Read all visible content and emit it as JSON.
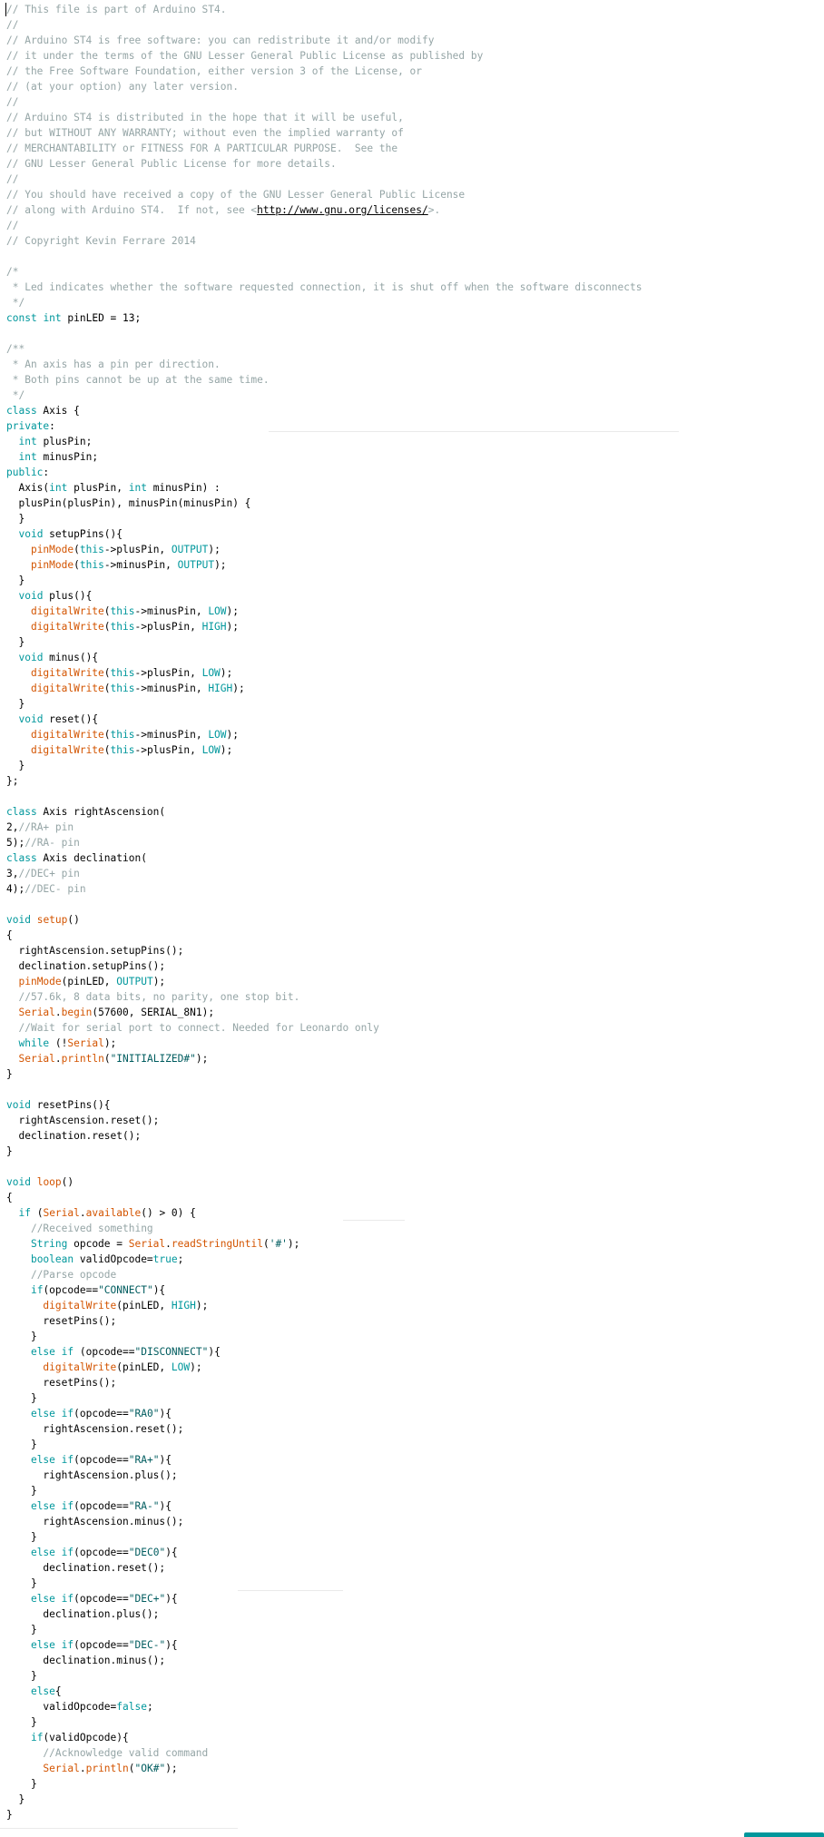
{
  "editor": {
    "colors": {
      "comment": "#95a5a6",
      "keyword": "#00979c",
      "function": "#d35400",
      "string": "#005c5f",
      "text": "#000000",
      "background": "#ffffff"
    },
    "lines": [
      [
        [
          "c",
          "// This file is part of Arduino ST4."
        ]
      ],
      [
        [
          "c",
          "//"
        ]
      ],
      [
        [
          "c",
          "// Arduino ST4 is free software: you can redistribute it and/or modify"
        ]
      ],
      [
        [
          "c",
          "// it under the terms of the GNU Lesser General Public License as published by"
        ]
      ],
      [
        [
          "c",
          "// the Free Software Foundation, either version 3 of the License, or"
        ]
      ],
      [
        [
          "c",
          "// (at your option) any later version."
        ]
      ],
      [
        [
          "c",
          "//"
        ]
      ],
      [
        [
          "c",
          "// Arduino ST4 is distributed in the hope that it will be useful,"
        ]
      ],
      [
        [
          "c",
          "// but WITHOUT ANY WARRANTY; without even the implied warranty of"
        ]
      ],
      [
        [
          "c",
          "// MERCHANTABILITY or FITNESS FOR A PARTICULAR PURPOSE.  See the"
        ]
      ],
      [
        [
          "c",
          "// GNU Lesser General Public License for more details."
        ]
      ],
      [
        [
          "c",
          "//"
        ]
      ],
      [
        [
          "c",
          "// You should have received a copy of the GNU Lesser General Public License"
        ]
      ],
      [
        [
          "c",
          "// along with Arduino ST4.  If not, see <"
        ],
        [
          "l",
          "http://www.gnu.org/licenses/"
        ],
        [
          "c",
          ">."
        ]
      ],
      [
        [
          "c",
          "//"
        ]
      ],
      [
        [
          "c",
          "// Copyright Kevin Ferrare 2014"
        ]
      ],
      [],
      [
        [
          "m",
          "/*"
        ]
      ],
      [
        [
          "m",
          " * Led indicates whether the software requested connection, it is shut off when the software disconnects"
        ]
      ],
      [
        [
          "m",
          " */"
        ]
      ],
      [
        [
          "k",
          "const"
        ],
        [
          "t",
          " "
        ],
        [
          "k",
          "int"
        ],
        [
          "t",
          " pinLED = 13;"
        ]
      ],
      [],
      [
        [
          "m",
          "/**"
        ]
      ],
      [
        [
          "m",
          " * An axis has a pin per direction."
        ]
      ],
      [
        [
          "m",
          " * Both pins cannot be up at the same time."
        ]
      ],
      [
        [
          "m",
          " */"
        ]
      ],
      [
        [
          "k",
          "class"
        ],
        [
          "t",
          " Axis {"
        ]
      ],
      [
        [
          "k",
          "private"
        ],
        [
          "t",
          ":"
        ]
      ],
      [
        [
          "t",
          "  "
        ],
        [
          "k",
          "int"
        ],
        [
          "t",
          " plusPin;"
        ]
      ],
      [
        [
          "t",
          "  "
        ],
        [
          "k",
          "int"
        ],
        [
          "t",
          " minusPin;"
        ]
      ],
      [
        [
          "k",
          "public"
        ],
        [
          "t",
          ":"
        ]
      ],
      [
        [
          "t",
          "  Axis("
        ],
        [
          "k",
          "int"
        ],
        [
          "t",
          " plusPin, "
        ],
        [
          "k",
          "int"
        ],
        [
          "t",
          " minusPin) :"
        ]
      ],
      [
        [
          "t",
          "  plusPin(plusPin), minusPin(minusPin) {"
        ]
      ],
      [
        [
          "t",
          "  }"
        ]
      ],
      [
        [
          "t",
          "  "
        ],
        [
          "k",
          "void"
        ],
        [
          "t",
          " setupPins(){"
        ]
      ],
      [
        [
          "t",
          "    "
        ],
        [
          "f",
          "pinMode"
        ],
        [
          "t",
          "("
        ],
        [
          "k",
          "this"
        ],
        [
          "t",
          "->plusPin, "
        ],
        [
          "k",
          "OUTPUT"
        ],
        [
          "t",
          ");"
        ]
      ],
      [
        [
          "t",
          "    "
        ],
        [
          "f",
          "pinMode"
        ],
        [
          "t",
          "("
        ],
        [
          "k",
          "this"
        ],
        [
          "t",
          "->minusPin, "
        ],
        [
          "k",
          "OUTPUT"
        ],
        [
          "t",
          ");"
        ]
      ],
      [
        [
          "t",
          "  }"
        ]
      ],
      [
        [
          "t",
          "  "
        ],
        [
          "k",
          "void"
        ],
        [
          "t",
          " plus(){"
        ]
      ],
      [
        [
          "t",
          "    "
        ],
        [
          "f",
          "digitalWrite"
        ],
        [
          "t",
          "("
        ],
        [
          "k",
          "this"
        ],
        [
          "t",
          "->minusPin, "
        ],
        [
          "k",
          "LOW"
        ],
        [
          "t",
          ");"
        ]
      ],
      [
        [
          "t",
          "    "
        ],
        [
          "f",
          "digitalWrite"
        ],
        [
          "t",
          "("
        ],
        [
          "k",
          "this"
        ],
        [
          "t",
          "->plusPin, "
        ],
        [
          "k",
          "HIGH"
        ],
        [
          "t",
          ");"
        ]
      ],
      [
        [
          "t",
          "  }"
        ]
      ],
      [
        [
          "t",
          "  "
        ],
        [
          "k",
          "void"
        ],
        [
          "t",
          " minus(){"
        ]
      ],
      [
        [
          "t",
          "    "
        ],
        [
          "f",
          "digitalWrite"
        ],
        [
          "t",
          "("
        ],
        [
          "k",
          "this"
        ],
        [
          "t",
          "->plusPin, "
        ],
        [
          "k",
          "LOW"
        ],
        [
          "t",
          ");"
        ]
      ],
      [
        [
          "t",
          "    "
        ],
        [
          "f",
          "digitalWrite"
        ],
        [
          "t",
          "("
        ],
        [
          "k",
          "this"
        ],
        [
          "t",
          "->minusPin, "
        ],
        [
          "k",
          "HIGH"
        ],
        [
          "t",
          ");"
        ]
      ],
      [
        [
          "t",
          "  }"
        ]
      ],
      [
        [
          "t",
          "  "
        ],
        [
          "k",
          "void"
        ],
        [
          "t",
          " reset(){"
        ]
      ],
      [
        [
          "t",
          "    "
        ],
        [
          "f",
          "digitalWrite"
        ],
        [
          "t",
          "("
        ],
        [
          "k",
          "this"
        ],
        [
          "t",
          "->minusPin, "
        ],
        [
          "k",
          "LOW"
        ],
        [
          "t",
          ");"
        ]
      ],
      [
        [
          "t",
          "    "
        ],
        [
          "f",
          "digitalWrite"
        ],
        [
          "t",
          "("
        ],
        [
          "k",
          "this"
        ],
        [
          "t",
          "->plusPin, "
        ],
        [
          "k",
          "LOW"
        ],
        [
          "t",
          ");"
        ]
      ],
      [
        [
          "t",
          "  }"
        ]
      ],
      [
        [
          "t",
          "};"
        ]
      ],
      [],
      [
        [
          "k",
          "class"
        ],
        [
          "t",
          " Axis rightAscension("
        ]
      ],
      [
        [
          "t",
          "2,"
        ],
        [
          "c",
          "//RA+ pin"
        ]
      ],
      [
        [
          "t",
          "5);"
        ],
        [
          "c",
          "//RA- pin"
        ]
      ],
      [
        [
          "k",
          "class"
        ],
        [
          "t",
          " Axis declination("
        ]
      ],
      [
        [
          "t",
          "3,"
        ],
        [
          "c",
          "//DEC+ pin"
        ]
      ],
      [
        [
          "t",
          "4);"
        ],
        [
          "c",
          "//DEC- pin"
        ]
      ],
      [],
      [
        [
          "k",
          "void"
        ],
        [
          "t",
          " "
        ],
        [
          "f",
          "setup"
        ],
        [
          "t",
          "()"
        ]
      ],
      [
        [
          "t",
          "{"
        ]
      ],
      [
        [
          "t",
          "  rightAscension.setupPins();"
        ]
      ],
      [
        [
          "t",
          "  declination.setupPins();"
        ]
      ],
      [
        [
          "t",
          "  "
        ],
        [
          "f",
          "pinMode"
        ],
        [
          "t",
          "(pinLED, "
        ],
        [
          "k",
          "OUTPUT"
        ],
        [
          "t",
          ");"
        ]
      ],
      [
        [
          "t",
          "  "
        ],
        [
          "c",
          "//57.6k, 8 data bits, no parity, one stop bit."
        ]
      ],
      [
        [
          "t",
          "  "
        ],
        [
          "f",
          "Serial"
        ],
        [
          "t",
          "."
        ],
        [
          "f",
          "begin"
        ],
        [
          "t",
          "(57600, SERIAL_8N1);"
        ]
      ],
      [
        [
          "t",
          "  "
        ],
        [
          "c",
          "//Wait for serial port to connect. Needed for Leonardo only"
        ]
      ],
      [
        [
          "t",
          "  "
        ],
        [
          "k",
          "while"
        ],
        [
          "t",
          " (!"
        ],
        [
          "f",
          "Serial"
        ],
        [
          "t",
          ");"
        ]
      ],
      [
        [
          "t",
          "  "
        ],
        [
          "f",
          "Serial"
        ],
        [
          "t",
          "."
        ],
        [
          "f",
          "println"
        ],
        [
          "t",
          "("
        ],
        [
          "s",
          "\"INITIALIZED#\""
        ],
        [
          "t",
          ");"
        ]
      ],
      [
        [
          "t",
          "}"
        ]
      ],
      [],
      [
        [
          "k",
          "void"
        ],
        [
          "t",
          " resetPins(){"
        ]
      ],
      [
        [
          "t",
          "  rightAscension.reset();"
        ]
      ],
      [
        [
          "t",
          "  declination.reset();"
        ]
      ],
      [
        [
          "t",
          "}"
        ]
      ],
      [],
      [
        [
          "k",
          "void"
        ],
        [
          "t",
          " "
        ],
        [
          "f",
          "loop"
        ],
        [
          "t",
          "()"
        ]
      ],
      [
        [
          "t",
          "{"
        ]
      ],
      [
        [
          "t",
          "  "
        ],
        [
          "k",
          "if"
        ],
        [
          "t",
          " ("
        ],
        [
          "f",
          "Serial"
        ],
        [
          "t",
          "."
        ],
        [
          "f",
          "available"
        ],
        [
          "t",
          "() > 0) {"
        ]
      ],
      [
        [
          "t",
          "    "
        ],
        [
          "c",
          "//Received something"
        ]
      ],
      [
        [
          "t",
          "    "
        ],
        [
          "k",
          "String"
        ],
        [
          "t",
          " opcode = "
        ],
        [
          "f",
          "Serial"
        ],
        [
          "t",
          "."
        ],
        [
          "f",
          "readStringUntil"
        ],
        [
          "t",
          "("
        ],
        [
          "s",
          "'#'"
        ],
        [
          "t",
          ");"
        ]
      ],
      [
        [
          "t",
          "    "
        ],
        [
          "k",
          "boolean"
        ],
        [
          "t",
          " validOpcode="
        ],
        [
          "k",
          "true"
        ],
        [
          "t",
          ";"
        ]
      ],
      [
        [
          "t",
          "    "
        ],
        [
          "c",
          "//Parse opcode"
        ]
      ],
      [
        [
          "t",
          "    "
        ],
        [
          "k",
          "if"
        ],
        [
          "t",
          "(opcode=="
        ],
        [
          "s",
          "\"CONNECT\""
        ],
        [
          "t",
          "){"
        ]
      ],
      [
        [
          "t",
          "      "
        ],
        [
          "f",
          "digitalWrite"
        ],
        [
          "t",
          "(pinLED, "
        ],
        [
          "k",
          "HIGH"
        ],
        [
          "t",
          ");"
        ]
      ],
      [
        [
          "t",
          "      resetPins();"
        ]
      ],
      [
        [
          "t",
          "    }"
        ]
      ],
      [
        [
          "t",
          "    "
        ],
        [
          "k",
          "else"
        ],
        [
          "t",
          " "
        ],
        [
          "k",
          "if"
        ],
        [
          "t",
          " (opcode=="
        ],
        [
          "s",
          "\"DISCONNECT\""
        ],
        [
          "t",
          "){"
        ]
      ],
      [
        [
          "t",
          "      "
        ],
        [
          "f",
          "digitalWrite"
        ],
        [
          "t",
          "(pinLED, "
        ],
        [
          "k",
          "LOW"
        ],
        [
          "t",
          ");"
        ]
      ],
      [
        [
          "t",
          "      resetPins();"
        ]
      ],
      [
        [
          "t",
          "    }"
        ]
      ],
      [
        [
          "t",
          "    "
        ],
        [
          "k",
          "else"
        ],
        [
          "t",
          " "
        ],
        [
          "k",
          "if"
        ],
        [
          "t",
          "(opcode=="
        ],
        [
          "s",
          "\"RA0\""
        ],
        [
          "t",
          "){"
        ]
      ],
      [
        [
          "t",
          "      rightAscension.reset();"
        ]
      ],
      [
        [
          "t",
          "    }"
        ]
      ],
      [
        [
          "t",
          "    "
        ],
        [
          "k",
          "else"
        ],
        [
          "t",
          " "
        ],
        [
          "k",
          "if"
        ],
        [
          "t",
          "(opcode=="
        ],
        [
          "s",
          "\"RA+\""
        ],
        [
          "t",
          "){"
        ]
      ],
      [
        [
          "t",
          "      rightAscension.plus();"
        ]
      ],
      [
        [
          "t",
          "    }"
        ]
      ],
      [
        [
          "t",
          "    "
        ],
        [
          "k",
          "else"
        ],
        [
          "t",
          " "
        ],
        [
          "k",
          "if"
        ],
        [
          "t",
          "(opcode=="
        ],
        [
          "s",
          "\"RA-\""
        ],
        [
          "t",
          "){"
        ]
      ],
      [
        [
          "t",
          "      rightAscension.minus();"
        ]
      ],
      [
        [
          "t",
          "    }"
        ]
      ],
      [
        [
          "t",
          "    "
        ],
        [
          "k",
          "else"
        ],
        [
          "t",
          " "
        ],
        [
          "k",
          "if"
        ],
        [
          "t",
          "(opcode=="
        ],
        [
          "s",
          "\"DEC0\""
        ],
        [
          "t",
          "){"
        ]
      ],
      [
        [
          "t",
          "      declination.reset();"
        ]
      ],
      [
        [
          "t",
          "    }"
        ]
      ],
      [
        [
          "t",
          "    "
        ],
        [
          "k",
          "else"
        ],
        [
          "t",
          " "
        ],
        [
          "k",
          "if"
        ],
        [
          "t",
          "(opcode=="
        ],
        [
          "s",
          "\"DEC+\""
        ],
        [
          "t",
          "){"
        ]
      ],
      [
        [
          "t",
          "      declination.plus();"
        ]
      ],
      [
        [
          "t",
          "    }"
        ]
      ],
      [
        [
          "t",
          "    "
        ],
        [
          "k",
          "else"
        ],
        [
          "t",
          " "
        ],
        [
          "k",
          "if"
        ],
        [
          "t",
          "(opcode=="
        ],
        [
          "s",
          "\"DEC-\""
        ],
        [
          "t",
          "){"
        ]
      ],
      [
        [
          "t",
          "      declination.minus();"
        ]
      ],
      [
        [
          "t",
          "    }"
        ]
      ],
      [
        [
          "t",
          "    "
        ],
        [
          "k",
          "else"
        ],
        [
          "t",
          "{"
        ]
      ],
      [
        [
          "t",
          "      validOpcode="
        ],
        [
          "k",
          "false"
        ],
        [
          "t",
          ";"
        ]
      ],
      [
        [
          "t",
          "    }"
        ]
      ],
      [
        [
          "t",
          "    "
        ],
        [
          "k",
          "if"
        ],
        [
          "t",
          "(validOpcode){"
        ]
      ],
      [
        [
          "t",
          "      "
        ],
        [
          "c",
          "//Acknowledge valid command"
        ]
      ],
      [
        [
          "t",
          "      "
        ],
        [
          "f",
          "Serial"
        ],
        [
          "t",
          "."
        ],
        [
          "f",
          "println"
        ],
        [
          "t",
          "("
        ],
        [
          "s",
          "\"OK#\""
        ],
        [
          "t",
          ");"
        ]
      ],
      [
        [
          "t",
          "    }"
        ]
      ],
      [
        [
          "t",
          "  }"
        ]
      ],
      [
        [
          "t",
          "}"
        ]
      ]
    ]
  }
}
